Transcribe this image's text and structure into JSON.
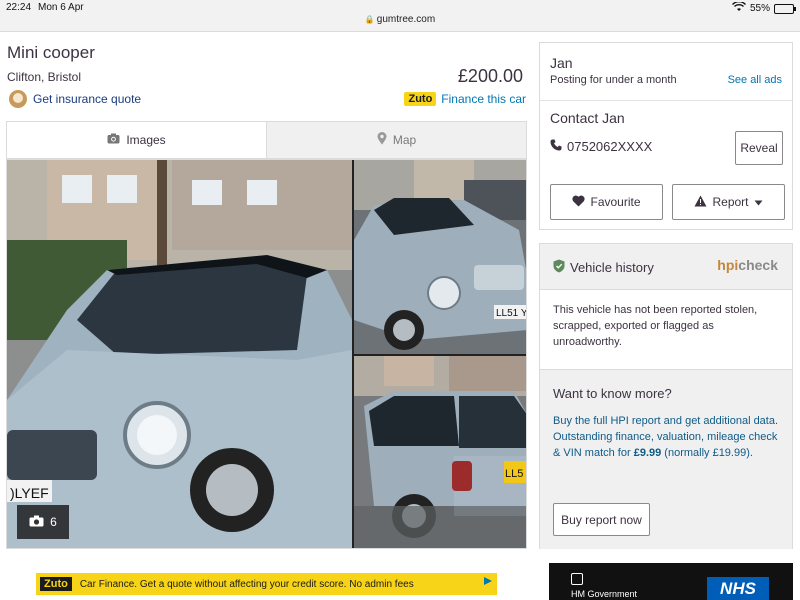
{
  "status_bar": {
    "time": "22:24",
    "date": "Mon 6 Apr",
    "url": "gumtree.com",
    "battery": "55%",
    "battery_level": 0.55
  },
  "listing": {
    "title": "Mini cooper",
    "location": "Clifton, Bristol",
    "price": "£200.00",
    "insurance_link": "Get insurance quote",
    "finance_brand": "Zuto",
    "finance_link": "Finance this car"
  },
  "tabs": [
    {
      "label": "Images",
      "active": true
    },
    {
      "label": "Map",
      "active": false
    }
  ],
  "gallery": {
    "photo_count": "6"
  },
  "seller": {
    "name": "Jan",
    "posting_duration": "Posting for under a month",
    "see_all_ads": "See all ads",
    "contact_heading": "Contact Jan",
    "phone": "0752062XXXX",
    "reveal_label": "Reveal",
    "favourite_label": "Favourite",
    "report_label": "Report"
  },
  "vehicle_history": {
    "title": "Vehicle history",
    "brand_left": "hpi",
    "brand_right": "check",
    "status_text": "This vehicle has not been reported stolen, scrapped, exported or flagged as unroadworthy.",
    "want_more": "Want to know more?",
    "buy_text_1": "Buy the full HPI report and get additional data.",
    "buy_text_2": "Outstanding finance, valuation, mileage check & VIN match for ",
    "buy_price": "£9.99",
    "buy_text_3": " (normally £19.99).",
    "buy_button": "Buy report now"
  },
  "ads": {
    "zuto_logo": "Zuto",
    "zuto_text": "Car Finance. Get a quote without affecting your credit score. No admin fees",
    "nhs_logo": "NHS",
    "hm_gov": "HM Government"
  },
  "colors": {
    "link_blue": "#0077b3",
    "zuto_yellow": "#f7d417",
    "nhs_blue": "#005eb8",
    "text_dark": "#3c3241"
  }
}
